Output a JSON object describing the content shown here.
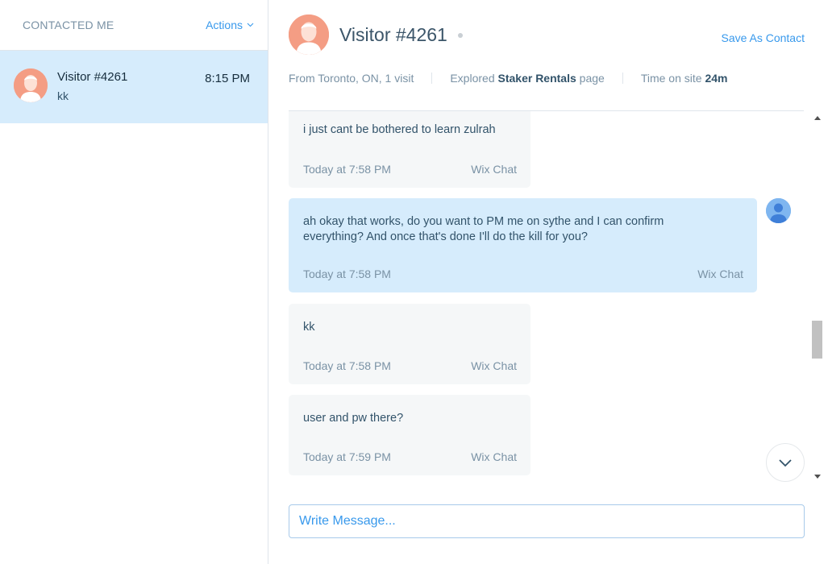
{
  "sidebar": {
    "title": "CONTACTED ME",
    "actions_label": "Actions",
    "conversations": [
      {
        "name": "Visitor #4261",
        "preview": "kk",
        "time": "8:15 PM"
      }
    ]
  },
  "header": {
    "visitor_name": "Visitor #4261",
    "save_contact_label": "Save As Contact",
    "from": "From Toronto, ON, 1 visit",
    "explored_prefix": "Explored",
    "explored_page": "Staker Rentals",
    "explored_suffix": "page",
    "time_on_site_label": "Time on site",
    "time_on_site_value": "24m"
  },
  "messages": [
    {
      "sender": "visitor",
      "text": "i just cant be bothered to learn zulrah",
      "time": "Today at 7:58 PM",
      "source": "Wix Chat"
    },
    {
      "sender": "agent",
      "text": "ah okay that works, do you want to PM me on sythe and I can confirm\neverything? And once that's done I'll do the kill for you?",
      "time": "Today at 7:58 PM",
      "source": "Wix Chat"
    },
    {
      "sender": "visitor",
      "text": "kk",
      "time": "Today at 7:58 PM",
      "source": "Wix Chat"
    },
    {
      "sender": "visitor",
      "text": "user and pw there?",
      "time": "Today at 7:59 PM",
      "source": "Wix Chat"
    }
  ],
  "composer": {
    "placeholder": "Write Message..."
  },
  "colors": {
    "accent": "#3899ec",
    "selected_bg": "#d6ecfc",
    "visitor_avatar": "#f49d84",
    "agent_avatar": "#7fb6f0"
  },
  "icons": [
    "visitor-avatar-icon",
    "agent-avatar-icon",
    "chevron-down-icon",
    "online-status-icon"
  ]
}
